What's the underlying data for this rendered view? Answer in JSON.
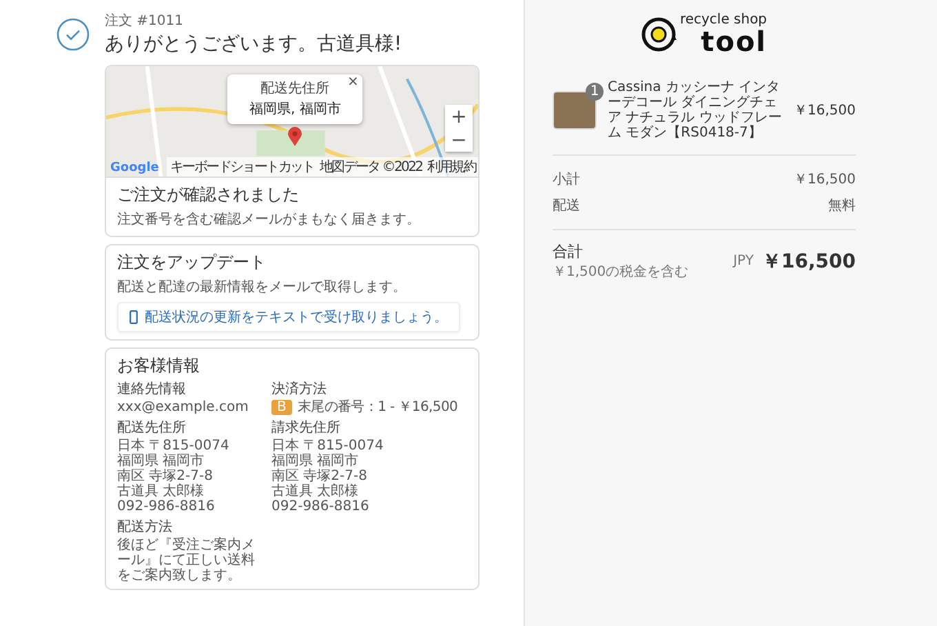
{
  "header": {
    "order_number": "注文 #1011",
    "title": "ありがとうございます。古道具様!"
  },
  "map": {
    "popup": {
      "label": "配送先住所",
      "value": "福岡県, 福岡市",
      "close": "×"
    },
    "zoom_in": "+",
    "zoom_out": "−",
    "brand": "Google",
    "footer": [
      "キーボードショートカット",
      "地図データ ©2022",
      "利用規約"
    ]
  },
  "confirmed": {
    "title": "ご注文が確認されました",
    "text": "注文番号を含む確認メールがまもなく届きます。"
  },
  "updates": {
    "title": "注文をアップデート",
    "text": "配送と配達の最新情報をメールで取得します。",
    "button": "配送状況の更新をテキストで受け取りましょう。"
  },
  "customer": {
    "title": "お客様情報",
    "contact": {
      "label": "連絡先情報",
      "value": "xxx@example.com"
    },
    "payment": {
      "label": "決済方法",
      "badge": "B",
      "value": "末尾の番号：1 - ￥16,500"
    },
    "shipping_address": {
      "label": "配送先住所",
      "lines": [
        "日本 〒815-0074",
        "福岡県 福岡市",
        "南区 寺塚2-7-8",
        "古道具 太郎様",
        "092-986-8816"
      ]
    },
    "billing_address": {
      "label": "請求先住所",
      "lines": [
        "日本 〒815-0074",
        "福岡県 福岡市",
        "南区 寺塚2-7-8",
        "古道具 太郎様",
        "092-986-8816"
      ]
    },
    "shipping_method": {
      "label": "配送方法",
      "value": "後ほど『受注ご案内メール』にて正しい送料をご案内致します。"
    }
  },
  "summary": {
    "logo": {
      "tagline": "recycle shop",
      "name": "tool"
    },
    "items": [
      {
        "quantity": "1",
        "name": "Cassina カッシーナ インターデコール ダイニングチェア ナチュラル ウッドフレーム モダン【RS0418-7】",
        "price": "￥16,500"
      }
    ],
    "lines": [
      {
        "label": "小計",
        "value": "￥16,500"
      },
      {
        "label": "配送",
        "value": "無料"
      }
    ],
    "total": {
      "label": "合計",
      "tax_note": "￥1,500の税金を含む",
      "currency": "JPY",
      "value": "￥16,500"
    }
  }
}
